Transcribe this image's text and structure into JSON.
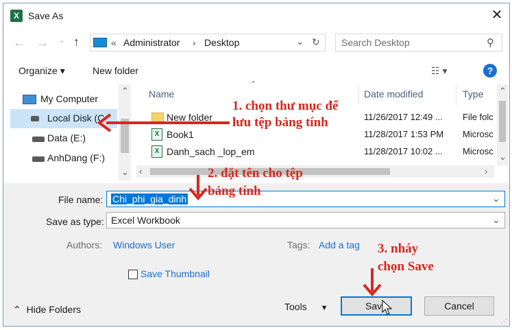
{
  "window": {
    "title": "Save As",
    "app_icon_letter": "X",
    "close_glyph": "✕"
  },
  "nav": {
    "back_glyph": "←",
    "forward_glyph": "→",
    "recent_glyph": "⌄",
    "up_glyph": "↑",
    "breadcrumb_prefix": "«",
    "breadcrumb": [
      "Administrator",
      "Desktop"
    ],
    "breadcrumb_sep": "›",
    "dropdown_glyph": "⌄",
    "refresh_glyph": "↻",
    "search_placeholder": "Search Desktop",
    "search_glyph": "⚲"
  },
  "toolbar": {
    "organize_label": "Organize ▾",
    "new_folder_label": "New folder",
    "view_glyph": "☷ ▾",
    "help_glyph": "?"
  },
  "nav_pane": {
    "items": [
      {
        "label": "My Computer",
        "icon": "computer-icon"
      },
      {
        "label": "Local Disk (C",
        "icon": "disk-icon",
        "selected": true
      },
      {
        "label": "Data (E:)",
        "icon": "disk-icon"
      },
      {
        "label": "AnhDang (F:)",
        "icon": "disk-icon"
      }
    ]
  },
  "file_list": {
    "columns": [
      "Name",
      "Date modified",
      "Type"
    ],
    "rows": [
      {
        "name": "New folder",
        "date": "11/26/2017 12:49 ...",
        "type": "File folc",
        "icon": "folder-icon"
      },
      {
        "name": "Book1",
        "date": "11/28/2017 1:53 PM",
        "type": "Microsc",
        "icon": "excel-icon"
      },
      {
        "name": "Danh_sach _lop_em",
        "date": "11/28/2017 10:02 ...",
        "type": "Microsc",
        "icon": "excel-icon"
      }
    ]
  },
  "form": {
    "file_name_label": "File name:",
    "file_name_value": "Chi_phi_gia_dinh",
    "save_as_type_label": "Save as type:",
    "save_as_type_value": "Excel Workbook",
    "authors_label": "Authors:",
    "authors_value": "Windows User",
    "tags_label": "Tags:",
    "tags_value": "Add a tag",
    "thumbnail_label": "Save Thumbnail",
    "hide_folders_label": "Hide Folders",
    "tools_label": "Tools",
    "save_label": "Save",
    "cancel_label": "Cancel"
  },
  "annotations": {
    "step1_line1": "1. chọn thư mục để",
    "step1_line2": "lưu tệp bảng tính",
    "step2_line1": "2. đặt tên cho tệp",
    "step2_line2": "bảng tính",
    "step3_line1": "3. nháy",
    "step3_line2": "chọn Save",
    "color": "#d9261c"
  },
  "colors": {
    "accent": "#0078d7",
    "link": "#1a6fd0",
    "selected_nav": "#cce4f7"
  }
}
